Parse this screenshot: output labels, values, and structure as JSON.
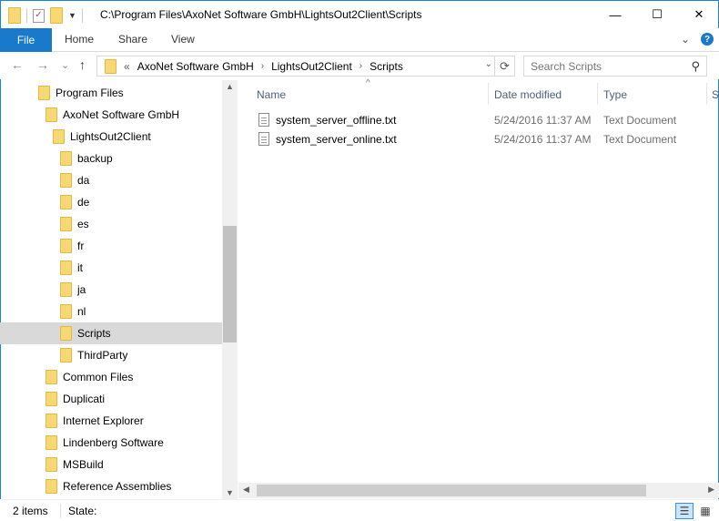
{
  "window": {
    "title": "C:\\Program Files\\AxoNet Software GmbH\\LightsOut2Client\\Scripts",
    "minimize_glyph": "—",
    "maximize_glyph": "☐",
    "close_glyph": "✕"
  },
  "ribbon": {
    "file_tab": "File",
    "tabs": [
      "Home",
      "Share",
      "View"
    ],
    "expand_glyph": "⌄",
    "help_glyph": "?"
  },
  "nav": {
    "back_glyph": "←",
    "forward_glyph": "→",
    "recent_glyph": "⌄",
    "up_glyph": "↑",
    "overflow": "«",
    "breadcrumbs": [
      "AxoNet Software GmbH",
      "LightsOut2Client",
      "Scripts"
    ],
    "separator_glyph": "›",
    "dropdown_glyph": "⌄",
    "refresh_glyph": "⟳",
    "search_placeholder": "Search Scripts",
    "search_glyph": "⚲"
  },
  "tree": {
    "items": [
      {
        "label": "Program Files",
        "level": 0
      },
      {
        "label": "AxoNet Software GmbH",
        "level": 1
      },
      {
        "label": "LightsOut2Client",
        "level": 2
      },
      {
        "label": "backup",
        "level": 3
      },
      {
        "label": "da",
        "level": 3
      },
      {
        "label": "de",
        "level": 3
      },
      {
        "label": "es",
        "level": 3
      },
      {
        "label": "fr",
        "level": 3
      },
      {
        "label": "it",
        "level": 3
      },
      {
        "label": "ja",
        "level": 3
      },
      {
        "label": "nl",
        "level": 3
      },
      {
        "label": "Scripts",
        "level": 3,
        "selected": true
      },
      {
        "label": "ThirdParty",
        "level": 3
      },
      {
        "label": "Common Files",
        "level": 1
      },
      {
        "label": "Duplicati",
        "level": 1
      },
      {
        "label": "Internet Explorer",
        "level": 1
      },
      {
        "label": "Lindenberg Software",
        "level": 1
      },
      {
        "label": "MSBuild",
        "level": 1
      },
      {
        "label": "Reference Assemblies",
        "level": 1
      }
    ],
    "scroll_up_glyph": "▲",
    "scroll_down_glyph": "▼"
  },
  "list": {
    "sort_glyph": "^",
    "columns": {
      "name": "Name",
      "date": "Date modified",
      "type": "Type",
      "size": "S"
    },
    "files": [
      {
        "name": "system_server_offline.txt",
        "date": "5/24/2016 11:37 AM",
        "type": "Text Document"
      },
      {
        "name": "system_server_online.txt",
        "date": "5/24/2016 11:37 AM",
        "type": "Text Document"
      }
    ],
    "scroll_left_glyph": "◀",
    "scroll_right_glyph": "▶"
  },
  "status": {
    "count": "2 items",
    "state": "State:",
    "details_view_glyph": "☰",
    "icons_view_glyph": "▦"
  },
  "colors": {
    "accent": "#1979ca",
    "selection": "#d9d9d9",
    "folder": "#f8d775"
  }
}
